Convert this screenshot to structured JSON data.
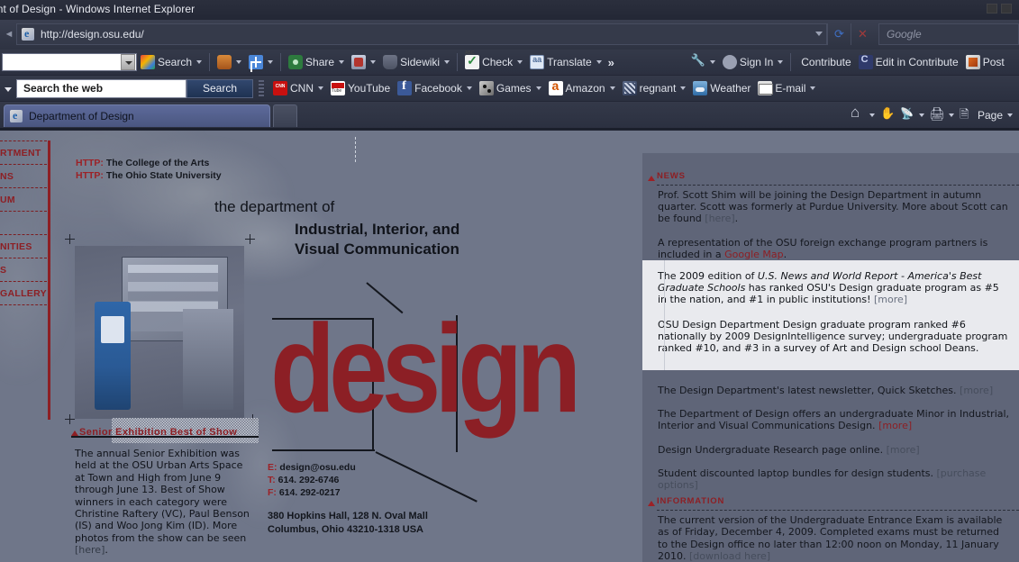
{
  "window": {
    "title": "ent of Design - Windows Internet Explorer"
  },
  "address_bar": {
    "url": "http://design.osu.edu/",
    "refresh_icon": "refresh-icon",
    "stop_icon": "stop-icon",
    "search_placeholder": "Google"
  },
  "google_toolbar": {
    "search_value": "",
    "items": [
      {
        "label": "Search",
        "icon": "google-icon",
        "caret": true
      },
      {
        "label": "",
        "icon": "wallet-icon",
        "caret": true
      },
      {
        "label": "",
        "icon": "plus-icon",
        "caret": true
      },
      {
        "label": "Share",
        "icon": "share-icon",
        "caret": true
      },
      {
        "label": "",
        "icon": "bookmark-icon",
        "caret": true
      },
      {
        "label": "Sidewiki",
        "icon": "sidewiki-icon",
        "caret": true
      },
      {
        "label": "Check",
        "icon": "spellcheck-icon",
        "caret": true
      },
      {
        "label": "Translate",
        "icon": "translate-icon",
        "caret": true
      }
    ],
    "overflow": "»",
    "settings_icon": "wrench-icon",
    "signin_label": "Sign In",
    "contribute_label": "Contribute",
    "edit_in_contribute_label": "Edit in Contribute",
    "post_label": "Post"
  },
  "web_toolbar": {
    "field_label": "Search the web",
    "search_button": "Search",
    "links": [
      {
        "label": "CNN",
        "icon": "cnn-icon",
        "caret": true
      },
      {
        "label": "YouTube",
        "icon": "youtube-icon",
        "caret": false
      },
      {
        "label": "Facebook",
        "icon": "facebook-icon",
        "caret": true
      },
      {
        "label": "Games",
        "icon": "games-icon",
        "caret": true
      },
      {
        "label": "Amazon",
        "icon": "amazon-icon",
        "caret": true
      },
      {
        "label": "regnant",
        "icon": "regnant-icon",
        "caret": true
      },
      {
        "label": "Weather",
        "icon": "weather-icon",
        "caret": false
      },
      {
        "label": "E-mail",
        "icon": "email-icon",
        "caret": true
      }
    ]
  },
  "tabs": {
    "active": "Department of Design",
    "new_tab_name": "new-tab"
  },
  "tab_tools": [
    {
      "name": "home-icon",
      "label": "",
      "caret": true
    },
    {
      "name": "hand-icon",
      "label": "",
      "caret": false
    },
    {
      "name": "rss-icon",
      "label": "",
      "caret": true
    },
    {
      "name": "print-icon",
      "label": "",
      "caret": true
    },
    {
      "name": "page-icon",
      "label": "Page",
      "caret": true
    }
  ],
  "page": {
    "header_links": [
      {
        "prefix": "HTTP:",
        "text": " The College of the Arts"
      },
      {
        "prefix": "HTTP:",
        "text": " The Ohio State University"
      }
    ],
    "dept_line": "the department of",
    "title_line_1": "Industrial, Interior, and",
    "title_line_2": "Visual Communication",
    "wordmark": "design",
    "nav_items": [
      "RTMENT",
      "NS",
      "UM",
      "",
      "NITIES",
      "S",
      "GALLERY"
    ],
    "exhibition": {
      "heading": "Senior Exhibition Best of Show",
      "body": "The annual Senior Exhibition was held at the OSU Urban Arts Space at Town and High from June 9 through June 13. Best of Show winners in each category were Christine Raftery (VC), Paul Benson (IS) and Woo Jong Kim (ID). More photos from the show can be seen ",
      "link": "[here]",
      "tail": "."
    },
    "contact": {
      "email_key": "E:",
      "email": " design@osu.edu",
      "phone_key": "T:",
      "phone": " 614. 292-6746",
      "fax_key": "F:",
      "fax": " 614. 292-0217",
      "address_1": "380 Hopkins Hall, 128 N. Oval Mall",
      "address_2": "Columbus, Ohio 43210-1318 USA"
    }
  },
  "news": {
    "section_news": "NEWS",
    "section_information": "INFORMATION",
    "items": [
      {
        "text": "Prof. Scott Shim will be joining the Design Department in autumn quarter. Scott was formerly at Purdue University. More about Scott can be found ",
        "link": "[here]",
        "link_style": "gray",
        "tail": "."
      },
      {
        "text": "A representation of the OSU foreign exchange program partners is included in a ",
        "link": "Google Map",
        "link_style": "red",
        "tail": "."
      }
    ],
    "highlighted": [
      {
        "pre": "The 2009 edition of ",
        "italic": "U.S. News and World Report - America's Best Graduate Schools",
        "post": " has ranked OSU's Design graduate program as #5 in the nation, and #1 in public institutions! ",
        "link": "[more]",
        "link_style": "gray",
        "tail": ""
      },
      {
        "pre": "OSU Design Department Design graduate program ranked #6 nationally by 2009 DesignIntelligence survey; undergraduate program ranked #10, and #3 in a survey of Art and Design school Deans.",
        "italic": "",
        "post": "",
        "link": "",
        "link_style": "gray",
        "tail": ""
      }
    ],
    "items_lower": [
      {
        "text": "The Design Department's latest newsletter, Quick Sketches. ",
        "link": "[more]",
        "link_style": "gray",
        "tail": ""
      },
      {
        "text": "The Department of Design offers an undergraduate Minor in Industrial, Interior and Visual Communications Design. ",
        "link": "[more]",
        "link_style": "red",
        "tail": ""
      },
      {
        "text": "Design Undergraduate Research page online. ",
        "link": "[more]",
        "link_style": "gray",
        "tail": ""
      },
      {
        "text": "Student discounted laptop bundles for design students. ",
        "link": "[purchase options]",
        "link_style": "gray",
        "tail": ""
      }
    ],
    "information_items": [
      {
        "text": "The current version of the Undergraduate Entrance Exam is available as of Friday, December 4, 2009. Completed exams must be returned to the Design office no later than 12:00 noon on Monday, 11 January 2010. ",
        "link": "[download here]",
        "link_style": "gray",
        "tail": ""
      }
    ]
  },
  "colors": {
    "brand_red": "#8d1f24",
    "page_bg": "#6f7689",
    "panel_bg": "#5f6578",
    "highlight_bg": "#e9eaee",
    "chrome_bg": "#2e3342"
  }
}
